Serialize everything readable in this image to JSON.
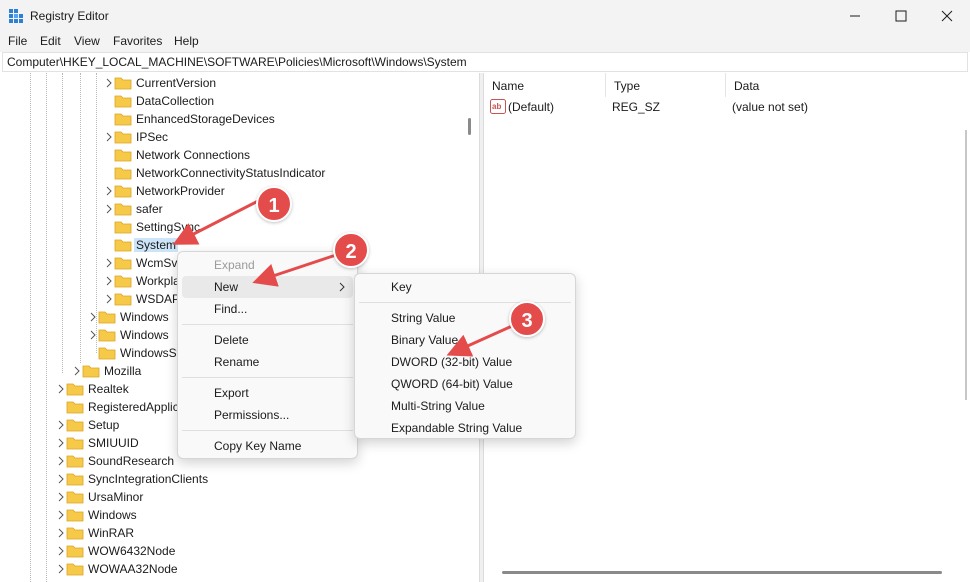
{
  "window": {
    "title": "Registry Editor"
  },
  "menu": [
    "File",
    "Edit",
    "View",
    "Favorites",
    "Help"
  ],
  "address": "Computer\\HKEY_LOCAL_MACHINE\\SOFTWARE\\Policies\\Microsoft\\Windows\\System",
  "tree": [
    {
      "label": "CurrentVersion",
      "expandable": true
    },
    {
      "label": "DataCollection",
      "expandable": false
    },
    {
      "label": "EnhancedStorageDevices",
      "expandable": false
    },
    {
      "label": "IPSec",
      "expandable": true
    },
    {
      "label": "Network Connections",
      "expandable": false
    },
    {
      "label": "NetworkConnectivityStatusIndicator",
      "expandable": false
    },
    {
      "label": "NetworkProvider",
      "expandable": true
    },
    {
      "label": "safer",
      "expandable": true
    },
    {
      "label": "SettingSync",
      "expandable": false
    },
    {
      "label": "System",
      "expandable": false,
      "selected": true
    },
    {
      "label": "WcmSvc",
      "expandable": true
    },
    {
      "label": "Workplace",
      "expandable": true
    },
    {
      "label": "WSDAPI",
      "expandable": true
    },
    {
      "label": "Windows",
      "expandable": true
    },
    {
      "label": "Windows",
      "expandable": true
    },
    {
      "label": "WindowsStore",
      "expandable": false
    },
    {
      "label": "Mozilla",
      "expandable": true
    },
    {
      "label": "Realtek",
      "expandable": true
    },
    {
      "label": "RegisteredApplications",
      "expandable": false
    },
    {
      "label": "Setup",
      "expandable": true
    },
    {
      "label": "SMIUUID",
      "expandable": true
    },
    {
      "label": "SoundResearch",
      "expandable": true
    },
    {
      "label": "SyncIntegrationClients",
      "expandable": true
    },
    {
      "label": "UrsaMinor",
      "expandable": true
    },
    {
      "label": "Windows",
      "expandable": true
    },
    {
      "label": "WinRAR",
      "expandable": true
    },
    {
      "label": "WOW6432Node",
      "expandable": true
    },
    {
      "label": "WOWAA32Node",
      "expandable": true
    }
  ],
  "values_pane": {
    "columns": [
      "Name",
      "Type",
      "Data"
    ],
    "rows": [
      {
        "name": "(Default)",
        "type": "REG_SZ",
        "data": "(value not set)"
      }
    ]
  },
  "context_menu": {
    "items": [
      "Expand",
      "New",
      "Find...",
      "Delete",
      "Rename",
      "Export",
      "Permissions...",
      "Copy Key Name"
    ]
  },
  "submenu": {
    "items": [
      "Key",
      "String Value",
      "Binary Value",
      "DWORD (32-bit) Value",
      "QWORD (64-bit) Value",
      "Multi-String Value",
      "Expandable String Value"
    ]
  },
  "callouts": [
    "1",
    "2",
    "3"
  ],
  "colors": {
    "callout": "#e44c4c",
    "selection": "#cce4f7",
    "folder": "#f7c948"
  },
  "icons": [
    "registry-app-icon",
    "minimize-icon",
    "maximize-icon",
    "close-icon",
    "folder-icon",
    "chevron-right-icon",
    "string-value-icon"
  ]
}
